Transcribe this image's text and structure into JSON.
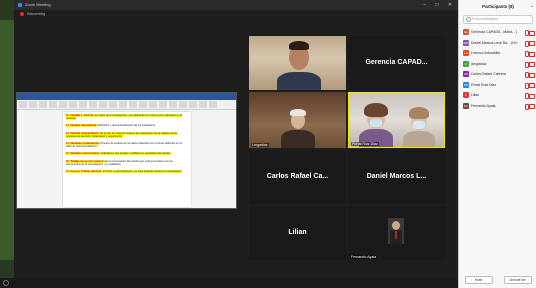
{
  "window": {
    "title": "Zoom Meeting",
    "controls": "–  □  ✕"
  },
  "recording": {
    "label": "Recording",
    "dot_color": "#e02828"
  },
  "shared_document": {
    "paragraphs": [
      {
        "num": "11.",
        "label": "Variable 1:",
        "text": "Describir los datos de la investigación y la calidad de los instrumentos utilizados en la muestra."
      },
      {
        "num": "12.",
        "label": "Variable dependiente:",
        "text": "Definición y operacionalización de los indicadores."
      },
      {
        "num": "13.",
        "label": "Variable independiente:",
        "text": "Es lo que se manipula durante la investigación de la relación de los procesos de atención, tratamiento y seguimiento."
      },
      {
        "num": "14.",
        "label": "Variables moderadoras:",
        "text": "Proceso de análisis de los datos obtenidos con criterios definidos en la tabla de operacionalización."
      },
      {
        "num": "15.",
        "label": "Variables intervinientes:",
        "text": "Indicadores que pueden modificar los resultados del estudio."
      },
      {
        "num": "16.",
        "label": "Trabajo de los tres Anexos:",
        "text": "Es la presentación del cuadro que incluye los datos con los instrumentos de la investigación y su validación."
      },
      {
        "num": "17.",
        "label": "Acceso, Trabajo Humano:",
        "text": "Informar el procedimiento y la ética aplicada durante la investigación."
      }
    ]
  },
  "tiles": {
    "gerencia": {
      "name": "Gerencia  CAPAD..."
    },
    "lmgadiaz": {
      "tag": "Lmgadiaz"
    },
    "portal_ruiz": {
      "tag": "Portal Ruiz Diaz"
    },
    "carlos": {
      "name": "Carlos  Rafael  Ca..."
    },
    "daniel": {
      "name": "Daniel  Marcos  L..."
    },
    "lilian": {
      "name": "Lilian"
    },
    "fernando": {
      "tag": "Fernando Ayala"
    }
  },
  "participants_panel": {
    "title": "Participants (8)",
    "close": "⌄",
    "search_placeholder": "Find a participant",
    "participants": [
      {
        "initials": "GC",
        "name": "Gerencia CAPADS - Maria...  (Host)",
        "color": "#d0543d"
      },
      {
        "initials": "DM",
        "name": "Daniel Marcos Lecti Ra... (Host)",
        "color": "#7e57c2"
      },
      {
        "initials": "LA",
        "name": "Lorenzo Arboabilla",
        "color": "#e64a19"
      },
      {
        "initials": "A",
        "name": "Amgadiaz",
        "color": "#43a047"
      },
      {
        "initials": "CR",
        "name": "Carlos Rafael Cabrera",
        "color": "#8e24aa"
      },
      {
        "initials": "PR",
        "name": "Portal Ruiz Diaz",
        "color": "#1e88e5"
      },
      {
        "initials": "L",
        "name": "Lilian",
        "color": "#e53935"
      },
      {
        "initials": "FA",
        "name": "Fernando Ayala",
        "color": "#6d4c41"
      }
    ],
    "invite_label": "Invite",
    "mute_all_label": "Unmute Me"
  }
}
